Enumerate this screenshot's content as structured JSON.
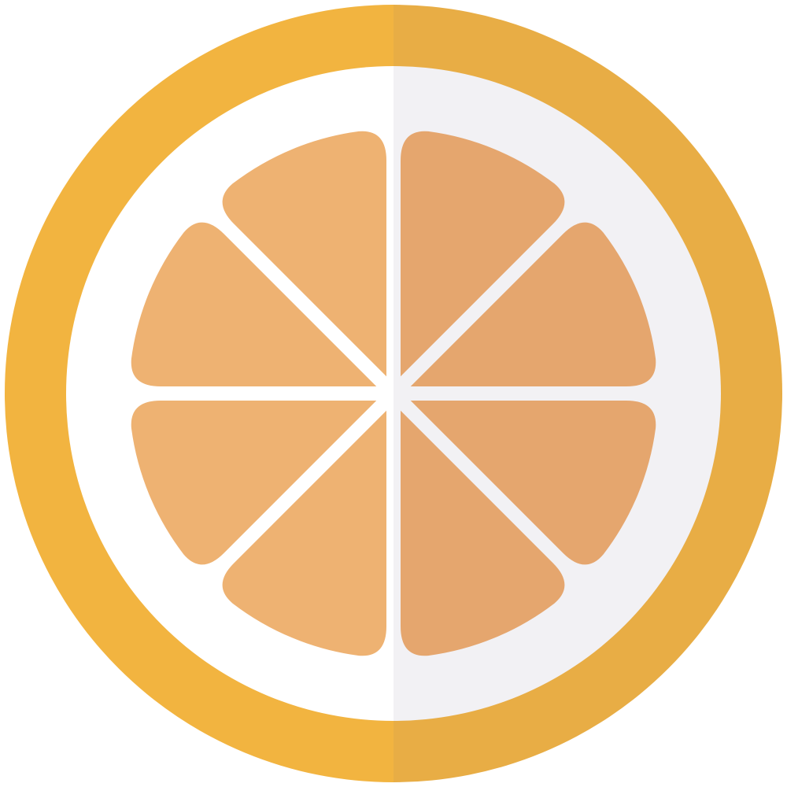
{
  "icon": {
    "name": "orange-slice-icon",
    "segment_count": 8
  },
  "colors": {
    "background": "#ffffff",
    "rind_left": "#f2b440",
    "rind_right": "#e8ad45",
    "pith_left": "#ffffff",
    "pith_right": "#f2f1f4",
    "segment_left": "#eeb272",
    "segment_right": "#e5a66e"
  }
}
